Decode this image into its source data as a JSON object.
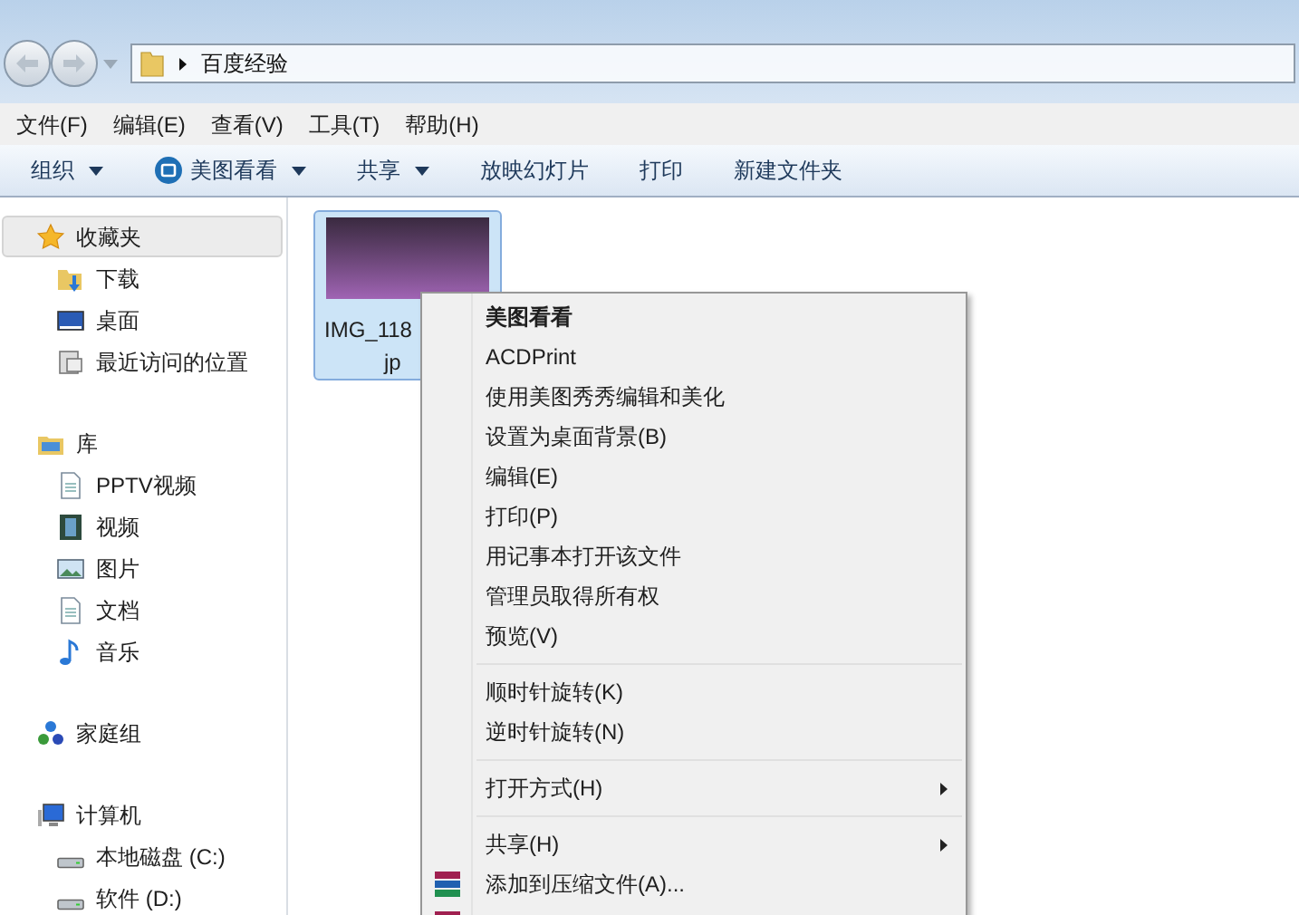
{
  "address_bar": {
    "path": "百度经验"
  },
  "menu_bar": [
    "文件(F)",
    "编辑(E)",
    "查看(V)",
    "工具(T)",
    "帮助(H)"
  ],
  "toolbar": [
    {
      "label": "组织",
      "dropdown": true,
      "kind": "plain"
    },
    {
      "label": "美图看看",
      "dropdown": true,
      "kind": "app"
    },
    {
      "label": "共享",
      "dropdown": true,
      "kind": "plain"
    },
    {
      "label": "放映幻灯片",
      "dropdown": false,
      "kind": "plain"
    },
    {
      "label": "打印",
      "dropdown": false,
      "kind": "plain"
    },
    {
      "label": "新建文件夹",
      "dropdown": false,
      "kind": "plain"
    }
  ],
  "sidebar": [
    {
      "label": "收藏夹",
      "kind": "favorites",
      "selected": true,
      "children": [
        {
          "label": "下载",
          "kind": "download",
          "selected": false
        },
        {
          "label": "桌面",
          "kind": "desktop",
          "selected": false
        },
        {
          "label": "最近访问的位置",
          "kind": "recent",
          "selected": false
        }
      ]
    },
    {
      "label": "库",
      "kind": "library",
      "selected": false,
      "children": [
        {
          "label": "PPTV视频",
          "kind": "doc",
          "selected": false
        },
        {
          "label": "视频",
          "kind": "video",
          "selected": false
        },
        {
          "label": "图片",
          "kind": "picture",
          "selected": false
        },
        {
          "label": "文档",
          "kind": "doc",
          "selected": false
        },
        {
          "label": "音乐",
          "kind": "music",
          "selected": false
        }
      ]
    },
    {
      "label": "家庭组",
      "kind": "homegroup",
      "selected": false
    },
    {
      "label": "计算机",
      "kind": "computer",
      "selected": false,
      "children": [
        {
          "label": "本地磁盘 (C:)",
          "kind": "drive",
          "selected": false
        },
        {
          "label": "软件 (D:)",
          "kind": "drive",
          "selected": false
        }
      ]
    }
  ],
  "files": [
    {
      "name_line_1": "IMG_118",
      "name_line_2": "jp",
      "selected": true
    }
  ],
  "context_menu": [
    {
      "kind": "item",
      "label": "美图看看",
      "default": true,
      "submenu": false
    },
    {
      "kind": "item",
      "label": "ACDPrint",
      "default": false,
      "submenu": false
    },
    {
      "kind": "item",
      "label": "使用美图秀秀编辑和美化",
      "default": false,
      "submenu": false
    },
    {
      "kind": "item",
      "label": "设置为桌面背景(B)",
      "default": false,
      "submenu": false
    },
    {
      "kind": "item",
      "label": "编辑(E)",
      "default": false,
      "submenu": false
    },
    {
      "kind": "item",
      "label": "打印(P)",
      "default": false,
      "submenu": false
    },
    {
      "kind": "item",
      "label": "用记事本打开该文件",
      "default": false,
      "submenu": false
    },
    {
      "kind": "item",
      "label": "管理员取得所有权",
      "default": false,
      "submenu": false
    },
    {
      "kind": "item",
      "label": "预览(V)",
      "default": false,
      "submenu": false
    },
    {
      "kind": "separator"
    },
    {
      "kind": "item",
      "label": "顺时针旋转(K)",
      "default": false,
      "submenu": false
    },
    {
      "kind": "item",
      "label": "逆时针旋转(N)",
      "default": false,
      "submenu": false
    },
    {
      "kind": "separator"
    },
    {
      "kind": "item",
      "label": "打开方式(H)",
      "default": false,
      "submenu": true
    },
    {
      "kind": "separator"
    },
    {
      "kind": "item",
      "label": "共享(H)",
      "default": false,
      "submenu": true
    },
    {
      "kind": "archive",
      "label": "添加到压缩文件(A)...",
      "default": false,
      "submenu": false
    },
    {
      "kind": "archive_cut"
    }
  ]
}
